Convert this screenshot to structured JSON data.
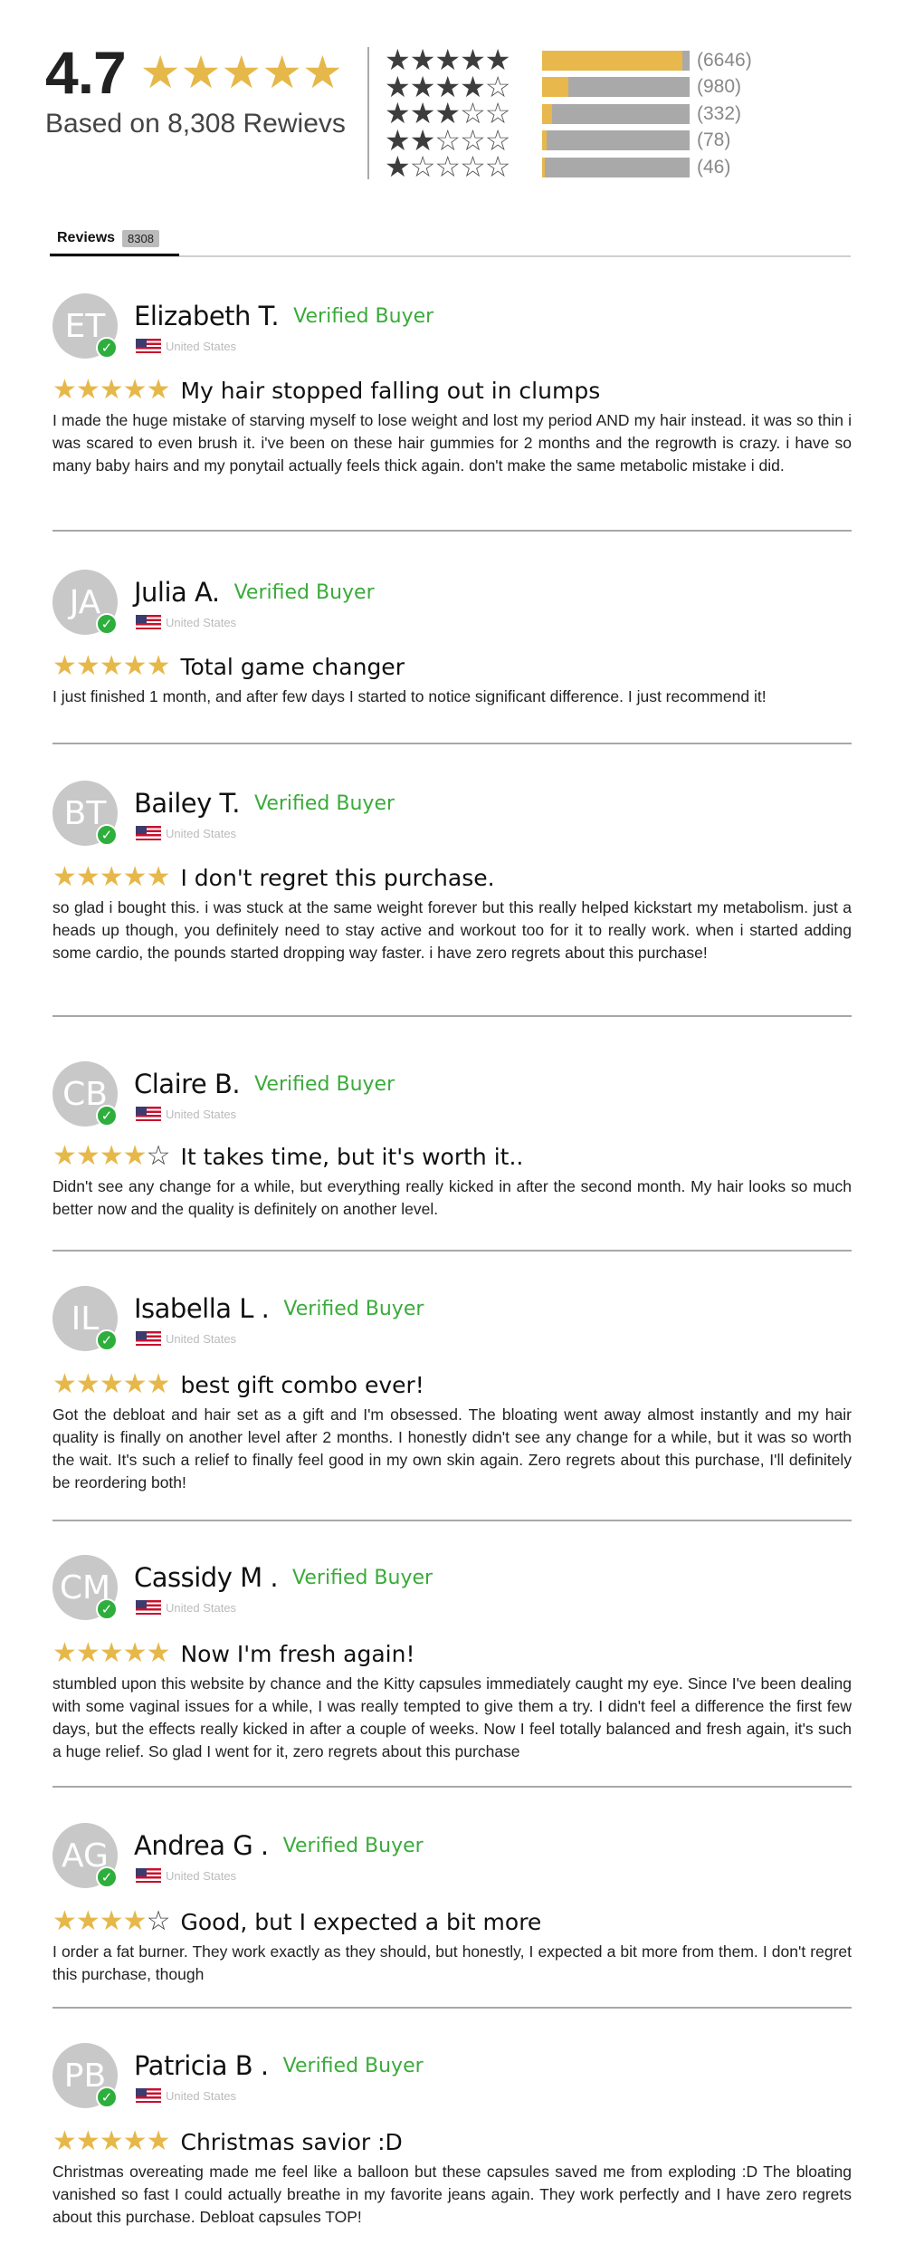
{
  "summary": {
    "average": "4.7",
    "average_stars": "★★★★★",
    "based_on": "Based on 8,308 Rewievs",
    "distribution": [
      {
        "stars_filled": "★★★★★",
        "stars_empty": "",
        "fraction": 0.95,
        "count": "(6646)"
      },
      {
        "stars_filled": "★★★★",
        "stars_empty": "☆",
        "fraction": 0.18,
        "count": "(980)"
      },
      {
        "stars_filled": "★★★",
        "stars_empty": "☆☆",
        "fraction": 0.07,
        "count": "(332)"
      },
      {
        "stars_filled": "★★",
        "stars_empty": "☆☆☆",
        "fraction": 0.03,
        "count": "(78)"
      },
      {
        "stars_filled": "★",
        "stars_empty": "☆☆☆☆",
        "fraction": 0.02,
        "count": "(46)"
      }
    ]
  },
  "tabs": {
    "active_label": "Reviews",
    "active_count": "8308"
  },
  "reviews": [
    {
      "initials": "ET",
      "name": "Elizabeth T.",
      "verified": "Verified Buyer",
      "country": "United States",
      "stars_filled": "★★★★★",
      "stars_empty": "",
      "title": "My hair stopped falling out in clumps",
      "body": "I made the huge mistake of starving myself to lose weight and lost my period AND my hair instead. it was so thin i was scared to even brush it. i've been on these hair gummies for 2 months and the regrowth is crazy. i have so many baby hairs and my ponytail actually feels thick again. don't make the same metabolic mistake i did."
    },
    {
      "initials": "JA",
      "name": "Julia A.",
      "verified": "Verified Buyer",
      "country": "United States",
      "stars_filled": "★★★★★",
      "stars_empty": "",
      "title": "Total game changer",
      "body": "I just finished 1 month, and after few days I started to notice significant difference. I just recommend it!"
    },
    {
      "initials": "BT",
      "name": "Bailey T.",
      "verified": "Verified Buyer",
      "country": "United States",
      "stars_filled": "★★★★★",
      "stars_empty": "",
      "title": "I don't regret this purchase.",
      "body": "so glad i bought this. i was stuck at the same weight forever but this really helped kickstart my metabolism. just a heads up though, you definitely need to stay active and workout too for it to really work. when i started adding some cardio, the pounds started dropping way faster. i have zero regrets about this purchase!"
    },
    {
      "initials": "CB",
      "name": "Claire B.",
      "verified": "Verified Buyer",
      "country": "United States",
      "stars_filled": "★★★★",
      "stars_empty": "☆",
      "title": "It takes time, but it's worth it..",
      "body": "Didn't see any change for a while, but everything really kicked in after the second month. My hair looks so much better now and the quality is definitely on another level."
    },
    {
      "initials": "IL",
      "name": "Isabella L .",
      "verified": "Verified Buyer",
      "country": "United States",
      "stars_filled": "★★★★★",
      "stars_empty": "",
      "title": "best gift combo ever!",
      "body": "Got the debloat and hair set as a gift and I'm obsessed. The bloating went away almost instantly and my hair quality is finally on another level after 2 months. I honestly didn't see any change for a while, but it was so worth the wait. It's such a relief to finally feel good in my own skin again. Zero regrets about this purchase, I'll definitely be reordering both!"
    },
    {
      "initials": "CM",
      "name": "Cassidy M .",
      "verified": "Verified Buyer",
      "country": "United States",
      "stars_filled": "★★★★★",
      "stars_empty": "",
      "title": "Now I'm fresh again!",
      "body": "stumbled upon this website by chance and the Kitty capsules immediately caught my eye. Since I've been dealing with some vaginal issues for a while, I was really tempted to give them a try. I didn't feel a difference the first few days, but the effects really kicked in after a couple of weeks. Now I feel totally balanced and fresh again, it's such a huge relief. So glad I went for it, zero regrets about this purchase"
    },
    {
      "initials": "AG",
      "name": "Andrea G .",
      "verified": "Verified Buyer",
      "country": "United States",
      "stars_filled": "★★★★",
      "stars_empty": "☆",
      "title": "Good, but I expected a bit more",
      "body": "I order a fat burner. They work exactly as they should, but honestly, I expected a bit more from them. I don't regret this purchase, though"
    },
    {
      "initials": "PB",
      "name": "Patricia B .",
      "verified": "Verified Buyer",
      "country": "United States",
      "stars_filled": "★★★★★",
      "stars_empty": "",
      "title": "Christmas savior :D",
      "body": "Christmas overeating made me feel like a balloon but these capsules saved me from exploding :D The bloating vanished so fast I could actually breathe in my favorite jeans again. They work perfectly and I have zero regrets about this purchase. Debloat capsules TOP!"
    }
  ]
}
